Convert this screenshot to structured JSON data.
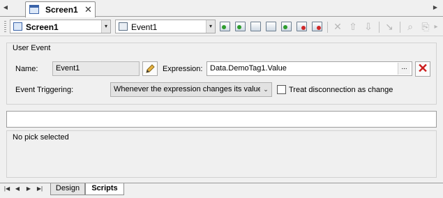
{
  "tabstrip": {
    "left_arrow": "◀",
    "right_arrow": "▶",
    "doc_tab": {
      "label": "Screen1",
      "close": "✕"
    }
  },
  "toolbar": {
    "screen_combo": {
      "value": "Screen1",
      "icon": "screen-icon"
    },
    "event_combo": {
      "value": "Event1",
      "icon": "event-icon"
    },
    "dropdown_glyph": "▾",
    "buttons": [
      {
        "name": "new-event-icon"
      },
      {
        "name": "insert-event-icon"
      },
      {
        "name": "event-properties-icon"
      },
      {
        "name": "event-table-icon"
      },
      {
        "name": "import-icon"
      },
      {
        "name": "refresh-icon"
      },
      {
        "name": "print-icon"
      }
    ],
    "disabled_glyphs": {
      "delete": "✕",
      "up": "⇧",
      "down": "⇩",
      "pick": "↘",
      "find": "⌕",
      "replace": "⎘",
      "more": "▸"
    }
  },
  "user_event": {
    "title": "User Event",
    "name_label": "Name:",
    "name_value": "Event1",
    "expression_label": "Expression:",
    "expression_value": "Data.DemoTag1.Value",
    "browse": "...",
    "clear": "✕",
    "triggering_label": "Event Triggering:",
    "triggering_value": "Whenever the expression changes its value",
    "triggering_dropdown": "⌄",
    "treat_disconnection_label": "Treat disconnection as change",
    "treat_disconnection_checked": false
  },
  "script": {
    "input_value": "",
    "pick_status": "No pick selected"
  },
  "bottom": {
    "nav": [
      "|◀",
      "◀",
      "▶",
      "▶|"
    ],
    "tabs": [
      {
        "label": "Design",
        "active": false
      },
      {
        "label": "Scripts",
        "active": true
      }
    ]
  }
}
